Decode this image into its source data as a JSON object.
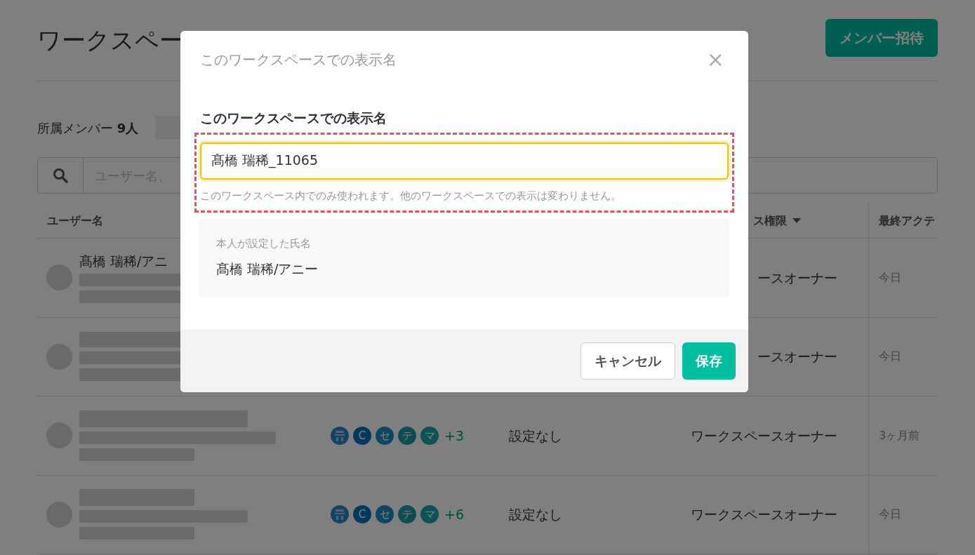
{
  "page": {
    "title": "ワークスペー",
    "invite_button": "メンバー招待",
    "member_label": "所属メンバー",
    "member_count": "9人",
    "search": {
      "placeholder": "ユーザー名、"
    }
  },
  "table": {
    "columns": [
      {
        "label": "ユーザー名"
      },
      {
        "label": "ス権限",
        "sortable": true
      },
      {
        "label": "最終アクテ"
      }
    ],
    "rows": [
      {
        "name": "髙橋 瑞稀/アニ",
        "workspaces": [],
        "more": "",
        "setting": "",
        "role": "ースオーナー",
        "last_active": "今日"
      },
      {
        "workspaces": [],
        "more": "",
        "setting": "",
        "role": "ースオーナー",
        "last_active": "今日"
      },
      {
        "workspaces": [
          {
            "kind": "picture"
          },
          {
            "kind": "letter",
            "letter": "C"
          },
          {
            "kind": "letter",
            "letter": "セ"
          },
          {
            "kind": "letter",
            "letter": "テ"
          },
          {
            "kind": "letter",
            "letter": "マ"
          }
        ],
        "more": "+3",
        "setting": "設定なし",
        "role": "ワークスペースオーナー",
        "last_active": "3ヶ月前"
      },
      {
        "workspaces": [
          {
            "kind": "picture"
          },
          {
            "kind": "letter",
            "letter": "C"
          },
          {
            "kind": "letter",
            "letter": "セ"
          },
          {
            "kind": "letter",
            "letter": "テ"
          },
          {
            "kind": "letter",
            "letter": "マ"
          }
        ],
        "more": "+6",
        "setting": "設定なし",
        "role": "ワークスペースオーナー",
        "last_active": "今日"
      }
    ]
  },
  "dialog": {
    "title": "このワークスペースでの表示名",
    "close": "×",
    "field_label": "このワークスペースでの表示名",
    "field_value": "髙橋 瑞稀_11065",
    "highlighted": true,
    "help": "このワークスペース内でのみ使われます。他のワークスペースでの表示は変わりません。",
    "profile_label": "本人が設定した氏名",
    "profile_name": "髙橋 瑞稀/アニー",
    "buttons": [
      {
        "label": "キャンセル",
        "kind": "secondary"
      },
      {
        "label": "保存",
        "kind": "primary"
      }
    ]
  }
}
